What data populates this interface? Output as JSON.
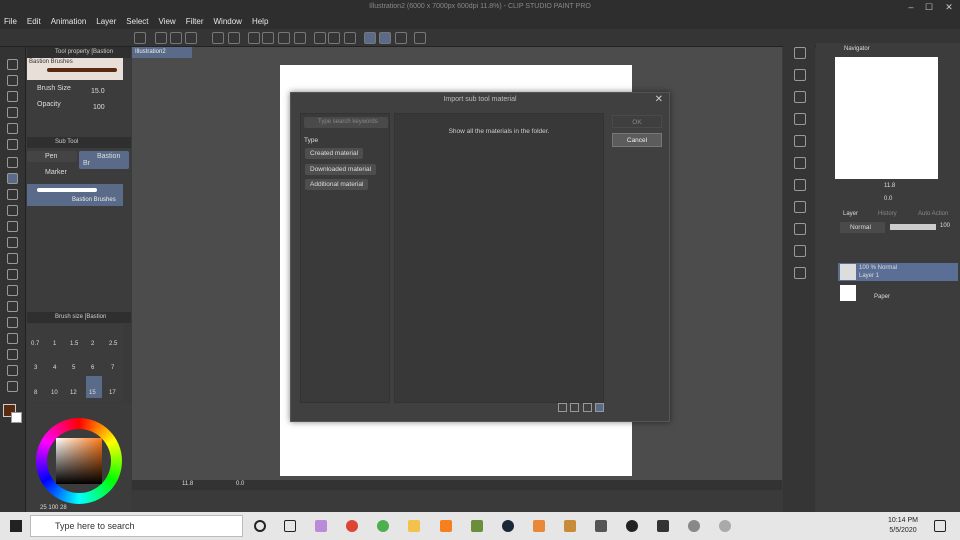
{
  "window": {
    "title": "Illustration2 (6000 x 7000px 600dpi 11.8%) - CLIP STUDIO PAINT PRO"
  },
  "menu": [
    "File",
    "Edit",
    "Animation",
    "Layer",
    "Select",
    "View",
    "Filter",
    "Window",
    "Help"
  ],
  "document_tab": "Illustration2",
  "tool_property": {
    "header": "Tool property [Bastion Brushes]",
    "brush_name": "Bastion Brushes",
    "brush_size_label": "Brush Size",
    "brush_size_value": "15.0",
    "opacity_label": "Opacity",
    "opacity_value": "100"
  },
  "sub_tool": {
    "header": "Sub Tool",
    "tabs": [
      "Pen",
      "Bastion Br"
    ],
    "marker": "Marker",
    "brush": "Bastion Brushes"
  },
  "brush_size_panel": {
    "header": "Brush size [Bastion Brushes]",
    "sizes": [
      "0.7",
      "1",
      "1.5",
      "2",
      "2.5",
      "3",
      "4",
      "5",
      "6",
      "7",
      "8",
      "10",
      "12",
      "15",
      "17"
    ]
  },
  "color_values": [
    "25",
    "100",
    "28"
  ],
  "dialog": {
    "title": "Import sub tool material",
    "search_placeholder": "Type search keywords",
    "type_label": "Type",
    "types": [
      "Created material",
      "Downloaded material",
      "Additional material"
    ],
    "message": "Show all the materials in the folder.",
    "ok": "OK",
    "cancel": "Cancel"
  },
  "canvas_bottom": {
    "zoom": "11.8",
    "rotation": "0.0"
  },
  "navigator": {
    "title": "Navigator",
    "zoom": "11.8",
    "angle": "0.0"
  },
  "layer_panel": {
    "tabs": [
      "Layer",
      "History",
      "Auto Action"
    ],
    "blend_mode": "Normal",
    "opacity": "100",
    "layers": [
      {
        "mode": "100 % Normal",
        "name": "Layer 1"
      },
      {
        "name": "Paper"
      }
    ]
  },
  "taskbar": {
    "search_placeholder": "Type here to search",
    "time": "10:14 PM",
    "date": "5/5/2020"
  },
  "colors": {
    "accent": "#5a6b8a",
    "selected_layer": "#5a6e96",
    "fg_color": "#5a2a10"
  }
}
